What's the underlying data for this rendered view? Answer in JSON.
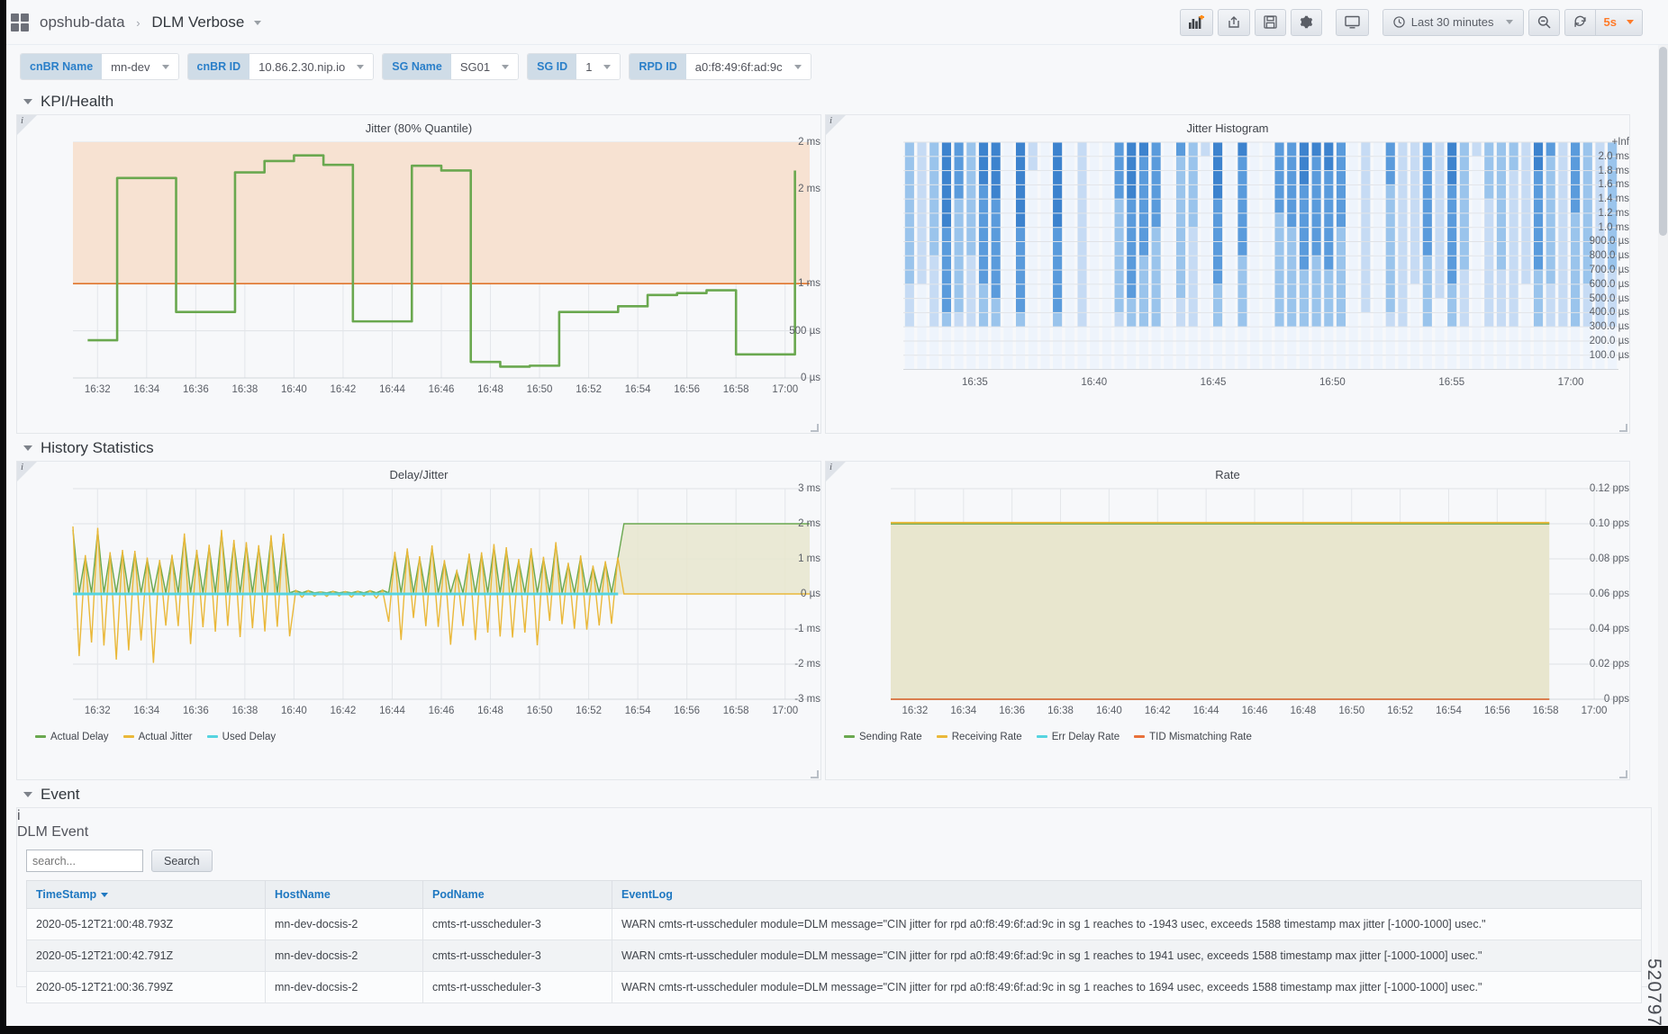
{
  "nav": {
    "brand_icon": "grid-apps-icon",
    "breadcrumb_folder": "opshub-data",
    "breadcrumb_sep": "›",
    "dashboard_title": "DLM Verbose",
    "buttons": [
      {
        "name": "add-panel-button",
        "title": "Add panel"
      },
      {
        "name": "share-dashboard-button",
        "title": "Share dashboard"
      },
      {
        "name": "save-dashboard-button",
        "title": "Save dashboard"
      },
      {
        "name": "dashboard-settings-button",
        "title": "Settings"
      },
      {
        "name": "tv-mode-button",
        "title": "Cycle view mode"
      }
    ],
    "time_range": "Last 30 minutes",
    "zoom_out_title": "Zoom out time range",
    "refresh_title": "Refresh dashboard",
    "refresh_interval": "5s"
  },
  "variables": [
    {
      "label": "cnBR Name",
      "value": "mn-dev"
    },
    {
      "label": "cnBR ID",
      "value": "10.86.2.30.nip.io"
    },
    {
      "label": "SG Name",
      "value": "SG01"
    },
    {
      "label": "SG ID",
      "value": "1"
    },
    {
      "label": "RPD ID",
      "value": "a0:f8:49:6f:ad:9c"
    }
  ],
  "rows": [
    {
      "title": "KPI/Health"
    },
    {
      "title": "History Statistics"
    },
    {
      "title": "Event"
    }
  ],
  "chart_data": [
    {
      "type": "line",
      "panel_name": "jitter-80-quantile-panel",
      "title": "Jitter (80% Quantile)",
      "xlabel": "",
      "ylabel": "",
      "ytick_labels": [
        "2 ms",
        "2 ms",
        "1 ms",
        "500 µs",
        "0 µs"
      ],
      "ytick_values": [
        2500,
        2000,
        1000,
        500,
        0
      ],
      "ylim": [
        0,
        2500
      ],
      "xtick_labels": [
        "16:32",
        "16:34",
        "16:36",
        "16:38",
        "16:40",
        "16:42",
        "16:44",
        "16:46",
        "16:48",
        "16:50",
        "16:52",
        "16:54",
        "16:56",
        "16:58",
        "17:00"
      ],
      "grid": true,
      "threshold": {
        "value": 1000,
        "label": "1 ms",
        "color": "#e0752d",
        "region_color": "#f7e2d2"
      },
      "series": [
        {
          "name": "Jitter",
          "color": "#6aa84f",
          "x": [
            16.5,
            16.54,
            16.55,
            16.57,
            16.6,
            16.63,
            16.64,
            16.66,
            16.69,
            16.71,
            16.74,
            16.77,
            16.79,
            16.82,
            16.85,
            16.88,
            16.9,
            16.93,
            16.95,
            16.98,
            17.0
          ],
          "values": [
            400,
            400,
            2120,
            2120,
            700,
            700,
            2180,
            2300,
            2350,
            2300,
            2250,
            2250,
            600,
            600,
            2250,
            2200,
            170,
            120,
            130,
            700,
            760,
            880,
            900,
            930,
            900,
            250,
            250,
            2200
          ]
        }
      ],
      "points": [
        {
          "t": "16:32",
          "v": 400
        },
        {
          "t": "16:33",
          "v": 2120
        },
        {
          "t": "16:35",
          "v": 2120
        },
        {
          "t": "16:36",
          "v": 700
        },
        {
          "t": "16:37",
          "v": 700
        },
        {
          "t": "16:38",
          "v": 2180
        },
        {
          "t": "16:39",
          "v": 2300
        },
        {
          "t": "16:41",
          "v": 2360
        },
        {
          "t": "16:43",
          "v": 2260
        },
        {
          "t": "16:44",
          "v": 600
        },
        {
          "t": "16:45",
          "v": 600
        },
        {
          "t": "16:46",
          "v": 2250
        },
        {
          "t": "16:47",
          "v": 2200
        },
        {
          "t": "16:49",
          "v": 170
        },
        {
          "t": "16:50",
          "v": 120
        },
        {
          "t": "16:51",
          "v": 130
        },
        {
          "t": "16:52",
          "v": 700
        },
        {
          "t": "16:53",
          "v": 700
        },
        {
          "t": "16:54",
          "v": 760
        },
        {
          "t": "16:55",
          "v": 880
        },
        {
          "t": "16:56",
          "v": 900
        },
        {
          "t": "16:57",
          "v": 930
        },
        {
          "t": "16:58",
          "v": 250
        },
        {
          "t": "16:59",
          "v": 250
        },
        {
          "t": "17:00",
          "v": 2200
        }
      ]
    },
    {
      "type": "heatmap",
      "panel_name": "jitter-histogram-panel",
      "title": "Jitter Histogram",
      "ytick_labels": [
        "+Inf",
        "2.0 ms",
        "1.8 ms",
        "1.6 ms",
        "1.4 ms",
        "1.2 ms",
        "1.0 ms",
        "900.0 µs",
        "800.0 µs",
        "700.0 µs",
        "600.0 µs",
        "500.0 µs",
        "400.0 µs",
        "300.0 µs",
        "200.0 µs",
        "100.0 µs"
      ],
      "xtick_labels": [
        "16:35",
        "16:40",
        "16:45",
        "16:50",
        "16:55",
        "17:00"
      ],
      "colorscale": [
        "#eef4fc",
        "#c6dbf4",
        "#9ac4ec",
        "#5a9bdc",
        "#3d83ce"
      ],
      "grid": true
    },
    {
      "type": "line",
      "panel_name": "delay-jitter-panel",
      "title": "Delay/Jitter",
      "ytick_labels": [
        "3 ms",
        "2 ms",
        "1 ms",
        "0 µs",
        "-1 ms",
        "-2 ms",
        "-3 ms"
      ],
      "ytick_values": [
        3000,
        2000,
        1000,
        0,
        -1000,
        -2000,
        -3000
      ],
      "ylim": [
        -3000,
        3000
      ],
      "xtick_labels": [
        "16:32",
        "16:34",
        "16:36",
        "16:38",
        "16:40",
        "16:42",
        "16:44",
        "16:46",
        "16:48",
        "16:50",
        "16:52",
        "16:54",
        "16:56",
        "16:58",
        "17:00"
      ],
      "grid": true,
      "legend_position": "bottom",
      "series": [
        {
          "name": "Actual Delay",
          "color": "#6aa84f"
        },
        {
          "name": "Actual Jitter",
          "color": "#eab839"
        },
        {
          "name": "Used Delay",
          "color": "#55d4e0"
        }
      ]
    },
    {
      "type": "area",
      "panel_name": "rate-panel",
      "title": "Rate",
      "ytick_labels": [
        "0.12 pps",
        "0.10 pps",
        "0.08 pps",
        "0.06 pps",
        "0.04 pps",
        "0.02 pps",
        "0 pps"
      ],
      "ytick_values": [
        0.12,
        0.1,
        0.08,
        0.06,
        0.04,
        0.02,
        0
      ],
      "ylim": [
        0,
        0.12
      ],
      "xtick_labels": [
        "16:32",
        "16:34",
        "16:36",
        "16:38",
        "16:40",
        "16:42",
        "16:44",
        "16:46",
        "16:48",
        "16:50",
        "16:52",
        "16:54",
        "16:56",
        "16:58",
        "17:00"
      ],
      "grid": true,
      "legend_position": "bottom",
      "series": [
        {
          "name": "Sending Rate",
          "color": "#6aa84f",
          "constant_value": 0.1
        },
        {
          "name": "Receiving Rate",
          "color": "#eab839",
          "constant_value": 0.1
        },
        {
          "name": "Err Delay Rate",
          "color": "#55d4e0",
          "constant_value": 0
        },
        {
          "name": "TID Mismatching Rate",
          "color": "#e8703a",
          "constant_value": 0
        }
      ]
    }
  ],
  "event": {
    "panel_title": "DLM Event",
    "search_placeholder": "search...",
    "search_value": "",
    "search_button": "Search",
    "columns": [
      "TimeStamp",
      "HostName",
      "PodName",
      "EventLog"
    ],
    "sorted_column": "TimeStamp",
    "rows": [
      {
        "TimeStamp": "2020-05-12T21:00:48.793Z",
        "HostName": "mn-dev-docsis-2",
        "PodName": "cmts-rt-usscheduler-3",
        "EventLog": "WARN cmts-rt-usscheduler module=DLM message=\"CIN jitter for rpd a0:f8:49:6f:ad:9c in sg 1 reaches to -1943 usec, exceeds 1588 timestamp max jitter [-1000-1000] usec.\""
      },
      {
        "TimeStamp": "2020-05-12T21:00:42.791Z",
        "HostName": "mn-dev-docsis-2",
        "PodName": "cmts-rt-usscheduler-3",
        "EventLog": "WARN cmts-rt-usscheduler module=DLM message=\"CIN jitter for rpd a0:f8:49:6f:ad:9c in sg 1 reaches to 1941 usec, exceeds 1588 timestamp max jitter [-1000-1000] usec.\""
      },
      {
        "TimeStamp": "2020-05-12T21:00:36.799Z",
        "HostName": "mn-dev-docsis-2",
        "PodName": "cmts-rt-usscheduler-3",
        "EventLog": "WARN cmts-rt-usscheduler module=DLM message=\"CIN jitter for rpd a0:f8:49:6f:ad:9c in sg 1 reaches to 1694 usec, exceeds 1588 timestamp max jitter [-1000-1000] usec.\""
      }
    ]
  },
  "watermark": "520797"
}
